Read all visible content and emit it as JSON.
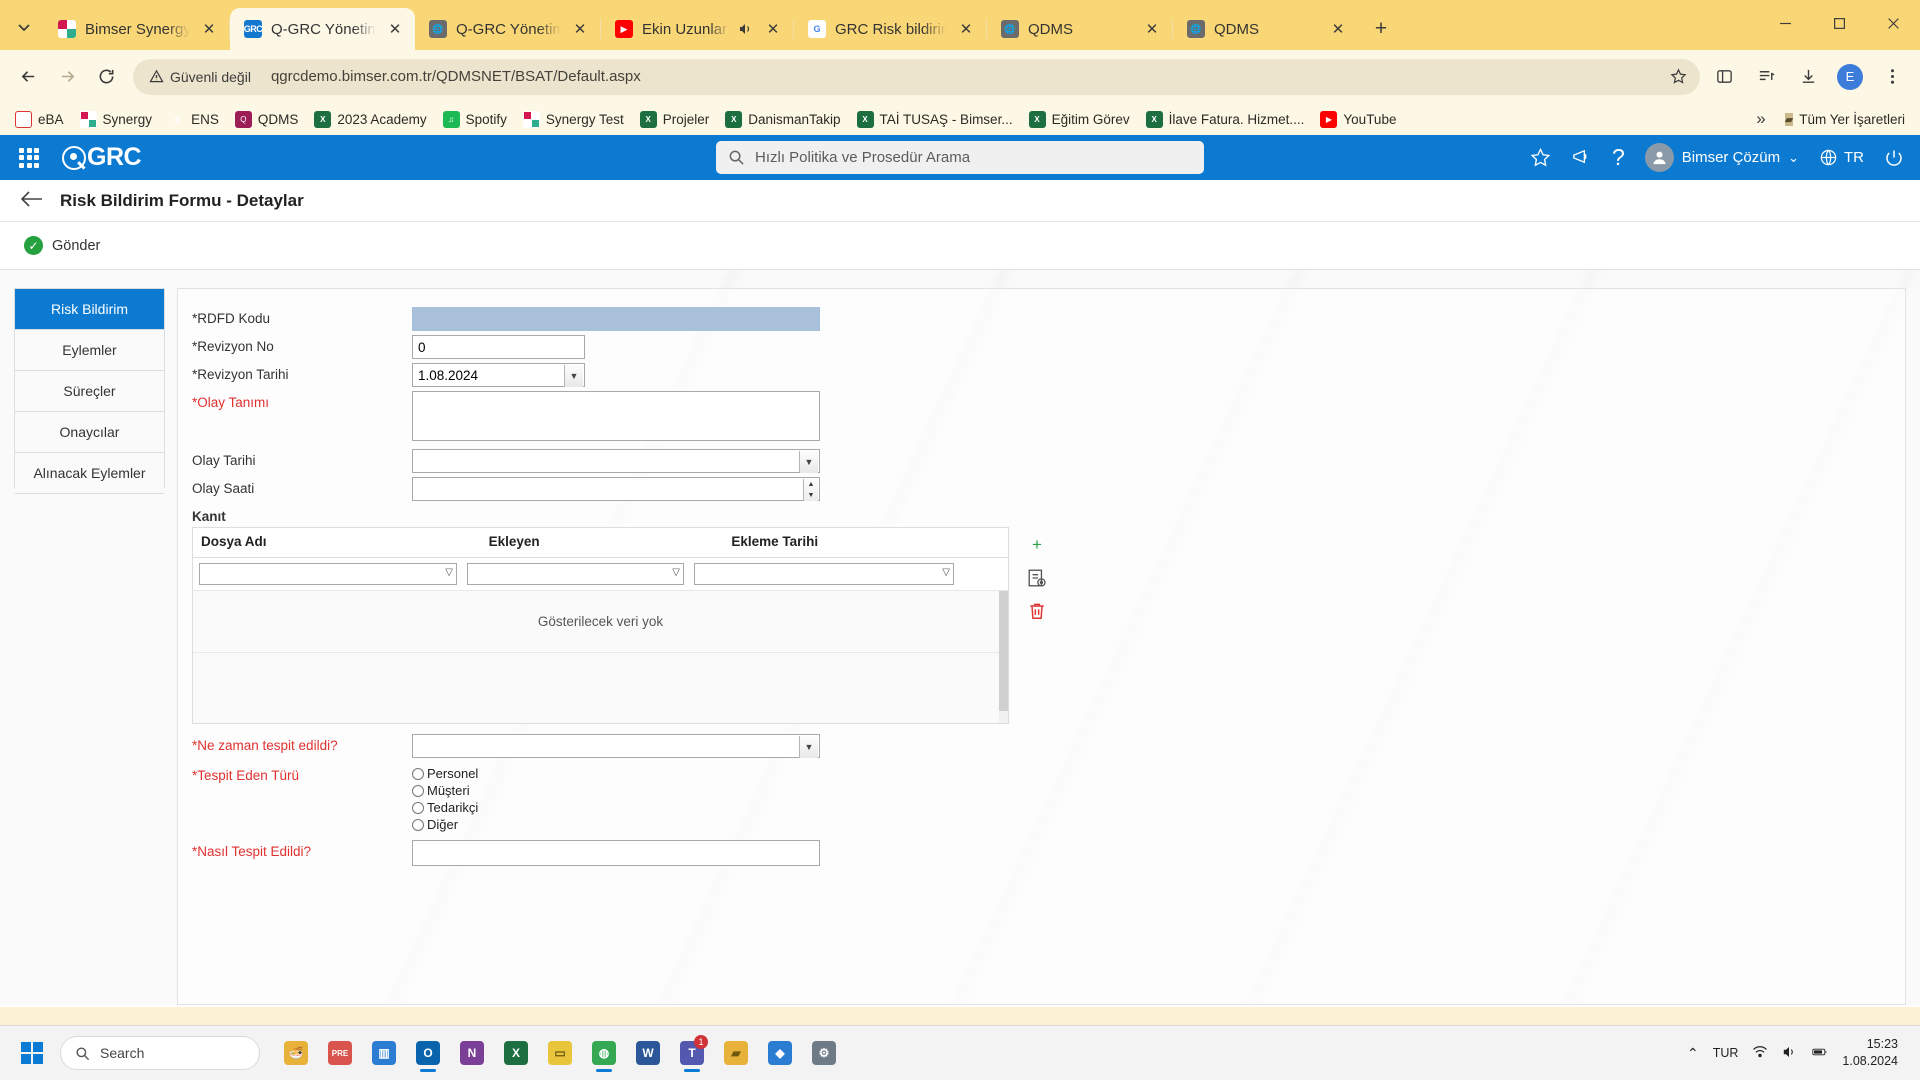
{
  "browser": {
    "tabs": [
      {
        "title": "Bimser Synergy",
        "favicon": "synergy-icon",
        "active": false,
        "audio": false
      },
      {
        "title": "Q-GRC Yönetim Siste",
        "favicon": "grc-icon",
        "active": true,
        "audio": false
      },
      {
        "title": "Q-GRC Yönetim Siste",
        "favicon": "globe-icon",
        "active": false,
        "audio": false
      },
      {
        "title": "Ekin Uzunlar - So",
        "favicon": "youtube-icon",
        "active": false,
        "audio": true
      },
      {
        "title": "GRC Risk bildirimi - G",
        "favicon": "google-icon",
        "active": false,
        "audio": false
      },
      {
        "title": "QDMS",
        "favicon": "globe-icon",
        "active": false,
        "audio": false
      },
      {
        "title": "QDMS",
        "favicon": "globe-icon",
        "active": false,
        "audio": false
      }
    ],
    "new_tab_label": "+",
    "toolbar": {
      "back_label": "Geri",
      "forward_label": "İleri",
      "reload_label": "Yenile",
      "security_text": "Güvenli değil",
      "url": "qgrcdemo.bimser.com.tr/QDMSNET/BSAT/Default.aspx",
      "profile_initial": "E"
    },
    "bookmarks": [
      {
        "label": "eBA",
        "icon": "eba-icon"
      },
      {
        "label": "Synergy",
        "icon": "synergy-icon"
      },
      {
        "label": "ENS",
        "icon": "ens-icon"
      },
      {
        "label": "QDMS",
        "icon": "qdms-icon"
      },
      {
        "label": "2023 Academy",
        "icon": "excel-icon"
      },
      {
        "label": "Spotify",
        "icon": "spotify-icon"
      },
      {
        "label": "Synergy Test",
        "icon": "synergy-icon"
      },
      {
        "label": "Projeler",
        "icon": "excel-icon"
      },
      {
        "label": "DanismanTakip",
        "icon": "excel-icon"
      },
      {
        "label": "TAİ TUSAŞ - Bimser...",
        "icon": "excel-icon"
      },
      {
        "label": "Eğitim Görev",
        "icon": "excel-icon"
      },
      {
        "label": "İlave Fatura. Hizmet....",
        "icon": "excel-icon"
      },
      {
        "label": "YouTube",
        "icon": "youtube-icon"
      }
    ],
    "bookmarks_overflow": "»",
    "all_bookmarks_label": "Tüm Yer İşaretleri"
  },
  "app": {
    "logo_text": "GRC",
    "search": {
      "placeholder": "Hızlı Politika ve Prosedür Arama"
    },
    "header_icons": [
      {
        "name": "favorites-icon",
        "glyph": "☆"
      },
      {
        "name": "announcements-icon",
        "glyph": "◁"
      },
      {
        "name": "help-icon",
        "glyph": "?"
      }
    ],
    "user": {
      "name": "Bimser Çözüm",
      "chevron": "⌄"
    },
    "language": {
      "code": "TR"
    },
    "logout_label": "Çıkış",
    "page_title": "Risk Bildirim Formu - Detaylar",
    "back_label": "Geri",
    "send_label": "Gönder"
  },
  "side_tabs": [
    {
      "label": "Risk Bildirim",
      "active": true
    },
    {
      "label": "Eylemler",
      "active": false
    },
    {
      "label": "Süreçler",
      "active": false
    },
    {
      "label": "Onaycılar",
      "active": false
    },
    {
      "label": "Alınacak Eylemler",
      "active": false
    }
  ],
  "form": {
    "rdfd_kodu": {
      "label": "*RDFD Kodu",
      "value": "",
      "required": true,
      "readonly": true
    },
    "revizyon_no": {
      "label": "*Revizyon No",
      "value": "0"
    },
    "revizyon_tarihi": {
      "label": "*Revizyon Tarihi",
      "value": "1.08.2024"
    },
    "olay_tanimi": {
      "label": "*Olay Tanımı",
      "value": ""
    },
    "olay_tarihi": {
      "label": "Olay Tarihi",
      "value": ""
    },
    "olay_saati": {
      "label": "Olay Saati",
      "value": ""
    },
    "kanit": {
      "label": "Kanıt",
      "columns": [
        "Dosya Adı",
        "Ekleyen",
        "Ekleme Tarihi"
      ],
      "rows": [],
      "empty_text": "Gösterilecek veri yok",
      "actions": [
        {
          "name": "add-attachment-button",
          "glyph": "+"
        },
        {
          "name": "view-attachment-button",
          "glyph": "▤"
        },
        {
          "name": "delete-attachment-button",
          "glyph": "🗑"
        }
      ]
    },
    "ne_zaman_tespit": {
      "label": "*Ne zaman tespit edildi?",
      "value": ""
    },
    "tespit_eden_turu": {
      "label": "*Tespit Eden Türü",
      "options": [
        "Personel",
        "Müşteri",
        "Tedarikçi",
        "Diğer"
      ],
      "selected": ""
    },
    "nasil_tespit_edildi": {
      "label": "*Nasıl Tespit Edildi?",
      "value": ""
    }
  },
  "taskbar": {
    "search_placeholder": "Search",
    "apps": [
      {
        "name": "widgets-icon",
        "glyph": "🍜",
        "color": "#e8b23a",
        "active": false,
        "badge": ""
      },
      {
        "name": "chrome-pinned-icon",
        "glyph": "PRE",
        "color": "#d9544d",
        "active": false,
        "badge": ""
      },
      {
        "name": "paint-icon",
        "glyph": "▥",
        "color": "#2b7cd3",
        "active": false,
        "badge": ""
      },
      {
        "name": "outlook-icon",
        "glyph": "O",
        "color": "#0a64ad",
        "active": true,
        "badge": ""
      },
      {
        "name": "onenote-icon",
        "glyph": "N",
        "color": "#7b3f98",
        "active": false,
        "badge": ""
      },
      {
        "name": "excel-icon",
        "glyph": "X",
        "color": "#1d6f42",
        "active": false,
        "badge": ""
      },
      {
        "name": "sticky-notes-icon",
        "glyph": "▭",
        "color": "#e8c53a",
        "active": false,
        "badge": ""
      },
      {
        "name": "chrome-icon",
        "glyph": "◍",
        "color": "#34a853",
        "active": true,
        "badge": ""
      },
      {
        "name": "word-icon",
        "glyph": "W",
        "color": "#2b579a",
        "active": false,
        "badge": ""
      },
      {
        "name": "teams-icon",
        "glyph": "T",
        "color": "#5558af",
        "active": true,
        "badge": "1"
      },
      {
        "name": "file-explorer-icon",
        "glyph": "▰",
        "color": "#e8b23a",
        "active": false,
        "badge": ""
      },
      {
        "name": "security-icon",
        "glyph": "◆",
        "color": "#2b7cd3",
        "active": false,
        "badge": ""
      },
      {
        "name": "settings-icon",
        "glyph": "⚙",
        "color": "#6e7b87",
        "active": false,
        "badge": ""
      }
    ],
    "tray": {
      "chevron": "⌃",
      "language": "TUR",
      "time": "15:23",
      "date": "1.08.2024"
    }
  },
  "colors": {
    "accent": "#0d7ad1",
    "browser_tab_bg": "#fad776",
    "browser_toolbar_bg": "#fdf7e6",
    "required_red": "#e03131",
    "readonly_field": "#a8c0da",
    "success_green": "#27a03f"
  }
}
